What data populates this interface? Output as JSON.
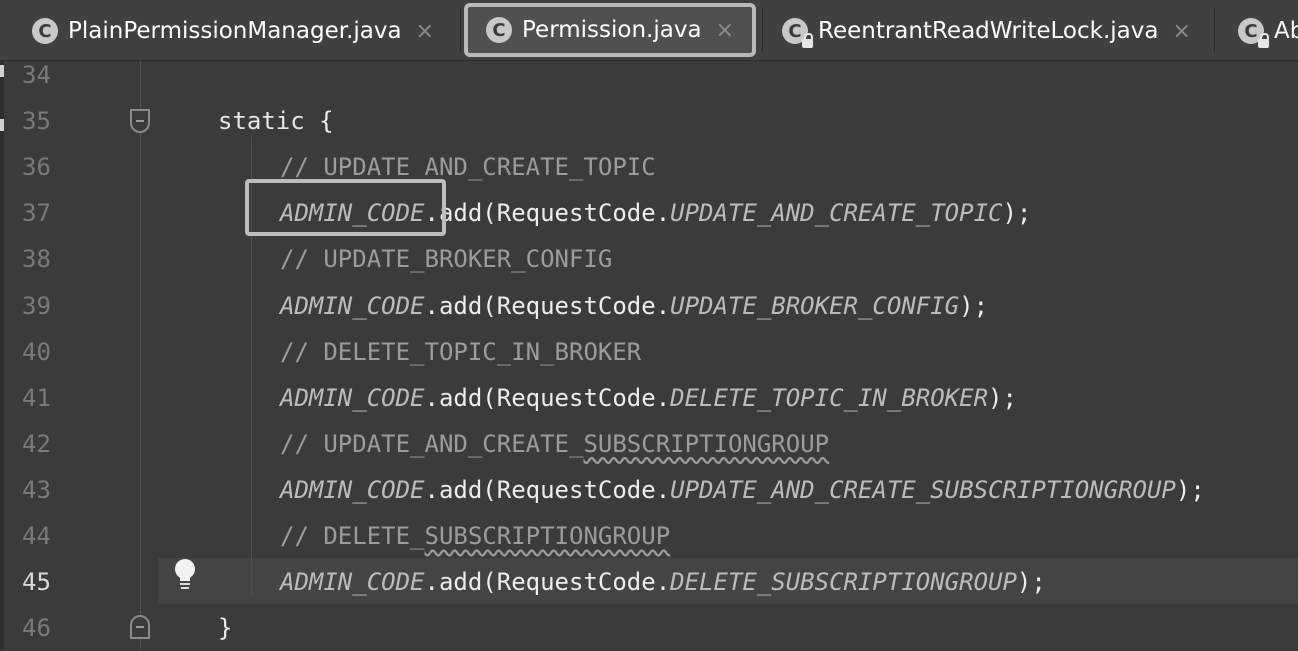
{
  "tabs": [
    {
      "label": "PlainPermissionManager.java",
      "icon": "class-icon",
      "icon_glyph": "C",
      "close": "×",
      "locked": false,
      "active": false
    },
    {
      "label": "Permission.java",
      "icon": "class-icon",
      "icon_glyph": "C",
      "close": "×",
      "locked": false,
      "active": true
    },
    {
      "label": "ReentrantReadWriteLock.java",
      "icon": "class-locked-icon",
      "icon_glyph": "C",
      "close": "×",
      "locked": true,
      "active": false
    },
    {
      "label": "Ab",
      "icon": "abstract-class-locked-icon",
      "icon_glyph": "C",
      "close": "",
      "locked": true,
      "active": false
    }
  ],
  "editor": {
    "current_line": "45",
    "lines": [
      {
        "number": "34",
        "kind": "blank"
      },
      {
        "number": "35",
        "kind": "static_open",
        "keyword": "static",
        "brace": "{"
      },
      {
        "number": "36",
        "kind": "comment",
        "prefix": "// ",
        "text": "UPDATE_AND_CREATE_TOPIC",
        "typo": ""
      },
      {
        "number": "37",
        "kind": "call",
        "field": "ADMIN_CODE",
        "method": ".add(RequestCode.",
        "constant": "UPDATE_AND_CREATE_TOPIC",
        "end": ");"
      },
      {
        "number": "38",
        "kind": "comment",
        "prefix": "// ",
        "text": "UPDATE_BROKER_CONFIG",
        "typo": ""
      },
      {
        "number": "39",
        "kind": "call",
        "field": "ADMIN_CODE",
        "method": ".add(RequestCode.",
        "constant": "UPDATE_BROKER_CONFIG",
        "end": ");"
      },
      {
        "number": "40",
        "kind": "comment",
        "prefix": "// ",
        "text": "DELETE_TOPIC_IN_BROKER",
        "typo": ""
      },
      {
        "number": "41",
        "kind": "call",
        "field": "ADMIN_CODE",
        "method": ".add(RequestCode.",
        "constant": "DELETE_TOPIC_IN_BROKER",
        "end": ");"
      },
      {
        "number": "42",
        "kind": "comment",
        "prefix": "// ",
        "text": "UPDATE_AND_CREATE_",
        "typo": "SUBSCRIPTIONGROUP"
      },
      {
        "number": "43",
        "kind": "call",
        "field": "ADMIN_CODE",
        "method": ".add(RequestCode.",
        "constant": "UPDATE_AND_CREATE_SUBSCRIPTIONGROUP",
        "end": ");"
      },
      {
        "number": "44",
        "kind": "comment",
        "prefix": "// ",
        "text": "DELETE_",
        "typo": "SUBSCRIPTIONGROUP"
      },
      {
        "number": "45",
        "kind": "call",
        "field": "ADMIN_CODE",
        "method": ".add(RequestCode.",
        "constant": "DELETE_SUBSCRIPTIONGROUP",
        "end": ");"
      },
      {
        "number": "46",
        "kind": "static_close",
        "brace": "}"
      }
    ]
  },
  "intention_icon": "lightbulb-icon",
  "colors": {
    "background": "#3b3b3b",
    "tab_bar": "#404040",
    "active_tab": "#505050",
    "highlight_border": "#bdbdbd",
    "comment": "#9c9c9c",
    "static_field": "#bcbcbc",
    "line_number": "#7a7a7a"
  }
}
